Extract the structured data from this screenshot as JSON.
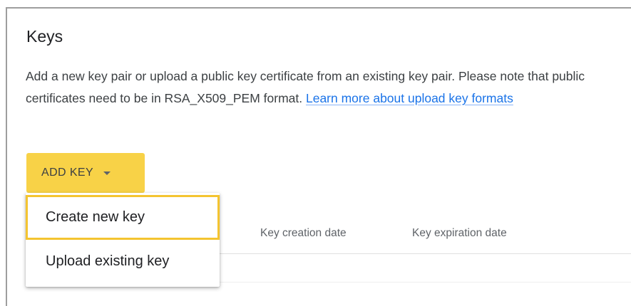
{
  "keys_section": {
    "title": "Keys",
    "description_text": "Add a new key pair or upload a public key certificate from an existing key pair. Please note that public certificates need to be in RSA_X509_PEM format. ",
    "learn_more_link": "Learn more about upload key formats",
    "add_key_label": "ADD KEY",
    "add_key_color": "#f8d247"
  },
  "dropdown": {
    "items": [
      {
        "label": "Create new key",
        "highlighted": true
      },
      {
        "label": "Upload existing key",
        "highlighted": false
      }
    ],
    "highlight_color": "#f4c430"
  },
  "table": {
    "columns": [
      {
        "label": "Key creation date"
      },
      {
        "label": "Key expiration date"
      }
    ]
  },
  "colors": {
    "link": "#1a73e8",
    "frame_border": "#9e9e9e"
  }
}
